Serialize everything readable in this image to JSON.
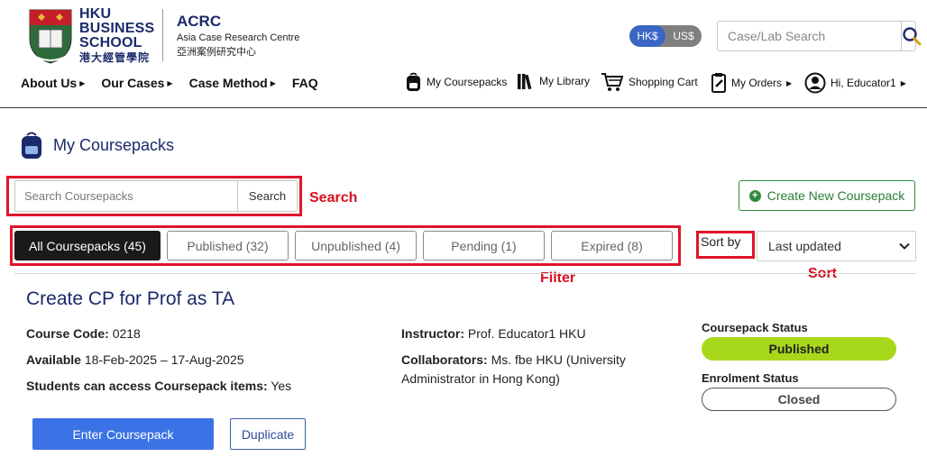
{
  "brand": {
    "school_line1": "HKU",
    "school_line2": "BUSINESS",
    "school_line3": "SCHOOL",
    "school_cn": "港大經管學院",
    "acrc": "ACRC",
    "acrc_full": "Asia Case Research Centre",
    "acrc_cn": "亞洲案例研究中心"
  },
  "currency": {
    "options": [
      "HK$",
      "US$"
    ],
    "selected": "HK$"
  },
  "top_search": {
    "placeholder": "Case/Lab Search",
    "icon": "search-icon"
  },
  "main_nav": [
    {
      "label": "About Us",
      "dropdown": true
    },
    {
      "label": "Our Cases",
      "dropdown": true
    },
    {
      "label": "Case Method",
      "dropdown": true
    },
    {
      "label": "FAQ",
      "dropdown": false
    }
  ],
  "user_nav": {
    "coursepacks": {
      "label": "My Coursepacks",
      "icon": "backpack-icon"
    },
    "library": {
      "label": "My Library",
      "icon": "books-icon"
    },
    "cart": {
      "label": "Shopping Cart",
      "icon": "cart-icon"
    },
    "orders": {
      "label": "My Orders",
      "icon": "clipboard-icon"
    },
    "account": {
      "label": "Hi, Educator1",
      "icon": "user-icon"
    }
  },
  "page": {
    "title": "My Coursepacks"
  },
  "cp_search": {
    "placeholder": "Search Coursepacks",
    "button": "Search"
  },
  "annotations": {
    "search": "Search",
    "filter": "Filter",
    "sort": "Sort"
  },
  "create_button": "Create New Coursepack",
  "filters": [
    {
      "label": "All Coursepacks (45)",
      "active": true
    },
    {
      "label": "Published (32)",
      "active": false
    },
    {
      "label": "Unpublished (4)",
      "active": false
    },
    {
      "label": "Pending (1)",
      "active": false
    },
    {
      "label": "Expired (8)",
      "active": false
    }
  ],
  "sort": {
    "label": "Sort by",
    "selected": "Last updated"
  },
  "coursepack": {
    "title": "Create CP for Prof as TA",
    "course_code_label": "Course Code:",
    "course_code": "0218",
    "available_label": "Available",
    "available": "18-Feb-2025 – 17-Aug-2025",
    "access_label": "Students can access Coursepack items:",
    "access": "Yes",
    "instructor_label": "Instructor:",
    "instructor": "Prof. Educator1 HKU",
    "collaborators_label": "Collaborators:",
    "collaborators_line1": "Ms. fbe HKU (University",
    "collaborators_line2": "Administrator in Hong Kong)",
    "status_label": "Coursepack Status",
    "status": "Published",
    "enrolment_label": "Enrolment Status",
    "enrolment": "Closed",
    "enter_button": "Enter Coursepack",
    "duplicate_button": "Duplicate"
  },
  "colors": {
    "brand_navy": "#1b2a6b",
    "annotation_red": "#e0142a",
    "published_green": "#a8d81c",
    "primary_blue": "#3b73e6",
    "create_green": "#2e8b3e"
  }
}
